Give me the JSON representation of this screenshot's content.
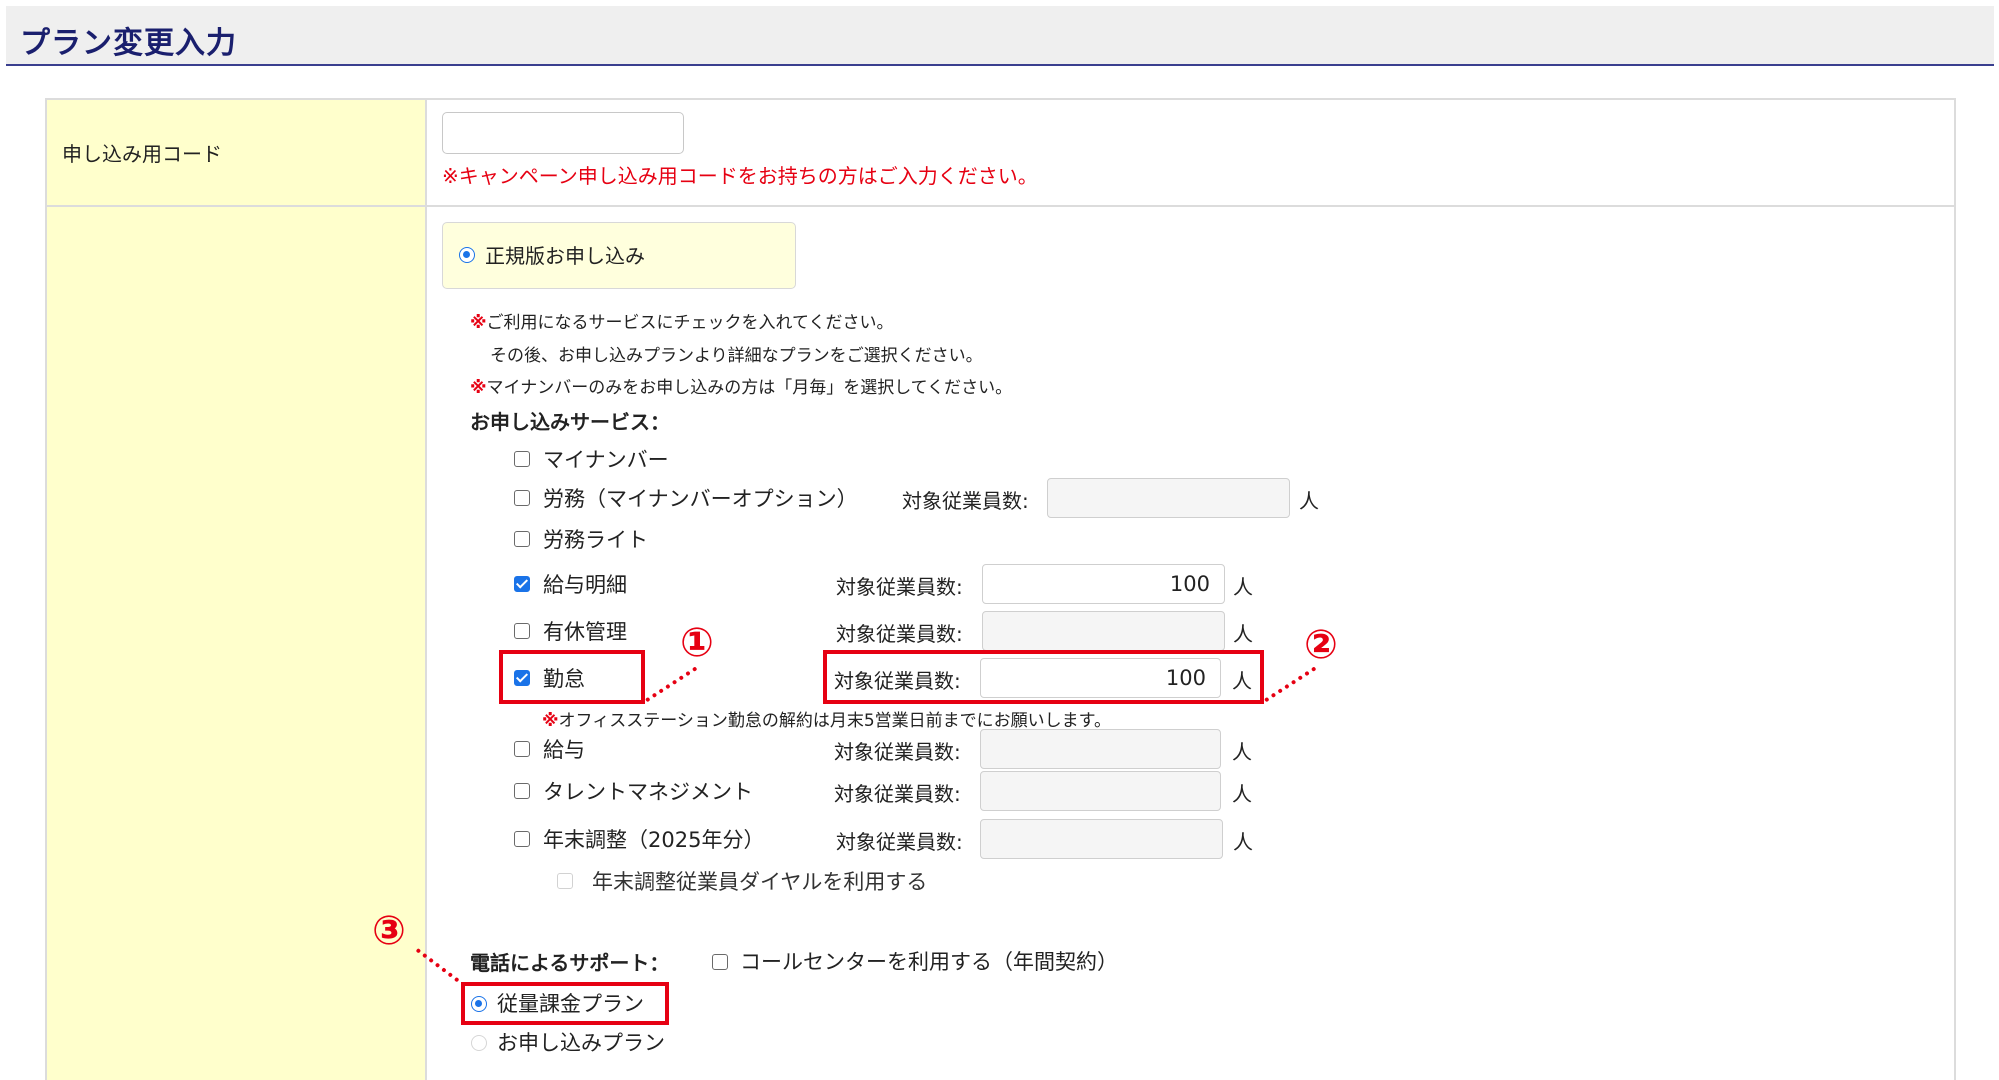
{
  "header": {
    "title": "プラン変更入力"
  },
  "code_row": {
    "label": "申し込み用コード",
    "input_value": "",
    "note": "※キャンペーン申し込み用コードをお持ちの方はご入力ください。"
  },
  "plan_type": {
    "label": "正規版お申し込み"
  },
  "notes": {
    "mark": "※",
    "line1": "ご利用になるサービスにチェックを入れてください。",
    "line2": "その後、お申し込みプランより詳細なプランをご選択ください。",
    "line3": "マイナンバーのみをお申し込みの方は「月毎」を選択してください。"
  },
  "services_title": "お申し込みサービス：",
  "emp_label": "対象従業員数:",
  "unit": "人",
  "services": [
    {
      "label": "マイナンバー",
      "checked": false,
      "count": null
    },
    {
      "label": "労務（マイナンバーオプション）",
      "checked": false,
      "count": ""
    },
    {
      "label": "労務ライト",
      "checked": false,
      "count": null
    },
    {
      "label": "給与明細",
      "checked": true,
      "count": "100"
    },
    {
      "label": "有休管理",
      "checked": false,
      "count": ""
    },
    {
      "label": "勤怠",
      "checked": true,
      "count": "100"
    },
    {
      "label": "給与",
      "checked": false,
      "count": ""
    },
    {
      "label": "タレントマネジメント",
      "checked": false,
      "count": ""
    },
    {
      "label": "年末調整（2025年分）",
      "checked": false,
      "count": ""
    }
  ],
  "kintai_note": "オフィスステーション勤怠の解約は月末5営業日前までにお願いします。",
  "yearend_dial": {
    "label": "年末調整従業員ダイヤルを利用する",
    "checked": false
  },
  "support": {
    "title": "電話によるサポート：",
    "option": "コールセンターを利用する（年間契約）"
  },
  "plans": [
    {
      "label": "従量課金プラン",
      "selected": true
    },
    {
      "label": "お申し込みプラン",
      "selected": false
    }
  ],
  "annotations": {
    "n1": "①",
    "n2": "②",
    "n3": "③"
  },
  "colors": {
    "accent": "#e60012",
    "header_rule": "#3a3f8f",
    "label_bg": "#ffffcc"
  }
}
